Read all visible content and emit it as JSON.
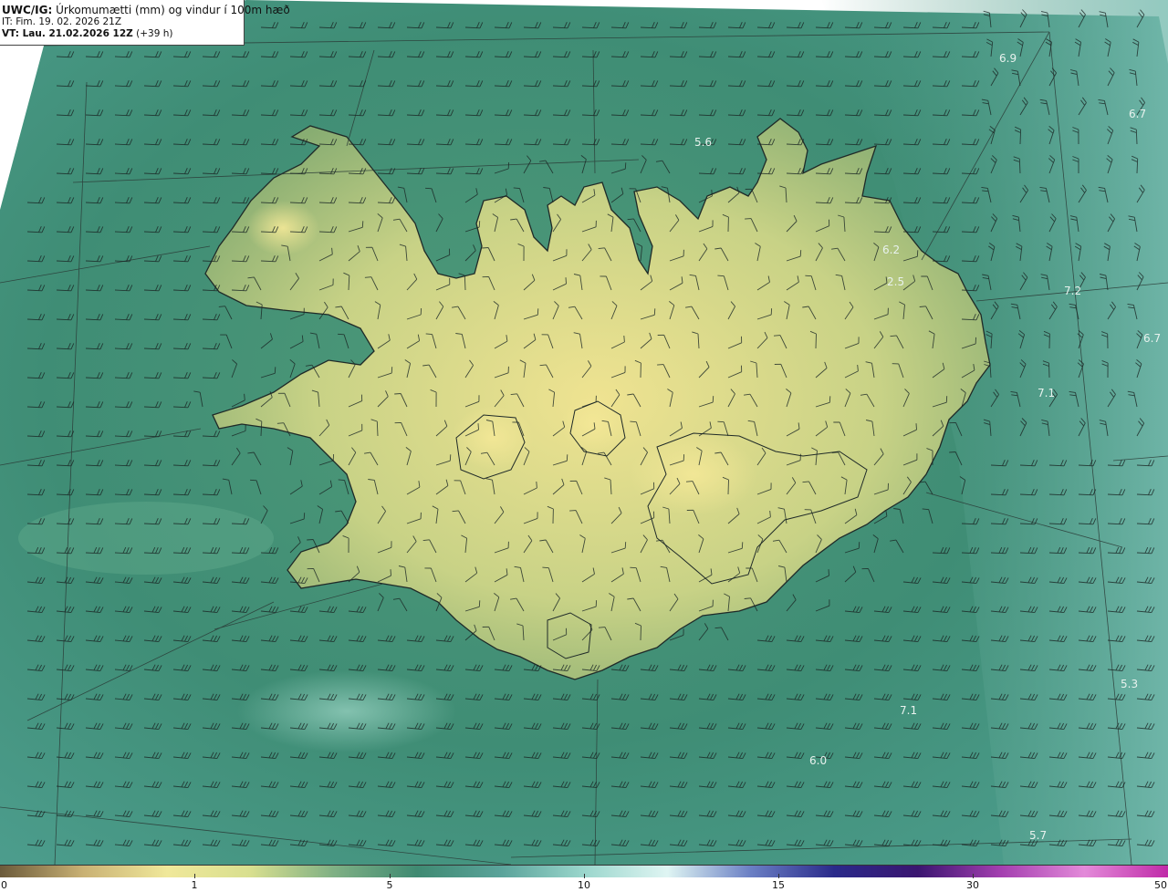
{
  "title": {
    "model": "UWC/IG:",
    "description": "Úrkomumætti (mm) og vindur í 100m hæð",
    "it_line": "IT: Fim. 19. 02. 2026 21Z",
    "vt_prefix": "VT: Lau. 21.02.2026 12Z",
    "vt_suffix": " (+39 h)"
  },
  "colorbar": {
    "ticks": [
      "0",
      "1",
      "5",
      "10",
      "15",
      "30",
      "50"
    ],
    "stops": [
      "#6b5a3a",
      "#c9b174",
      "#f0e89a",
      "#d8df8f",
      "#7fb084",
      "#3f8a72",
      "#5aa39a",
      "#9ad6cc",
      "#dff5f3",
      "#6a7fc4",
      "#2a2a8a",
      "#3a1570",
      "#a43fb0",
      "#e38ad9",
      "#c02aa8"
    ]
  },
  "map_labels": [
    {
      "text": "6.9"
    },
    {
      "text": "6.7"
    },
    {
      "text": "5.6"
    },
    {
      "text": "6.2"
    },
    {
      "text": "2.5"
    },
    {
      "text": "7.2"
    },
    {
      "text": "6.7"
    },
    {
      "text": "7.1"
    },
    {
      "text": "5.3"
    },
    {
      "text": "7.1"
    },
    {
      "text": "6.0"
    },
    {
      "text": "5.7"
    }
  ],
  "colors": {
    "ocean_dark": "#2f7f70",
    "ocean_light": "#6fb5a3",
    "land_low": "#8fb575",
    "land_high": "#efe391"
  }
}
